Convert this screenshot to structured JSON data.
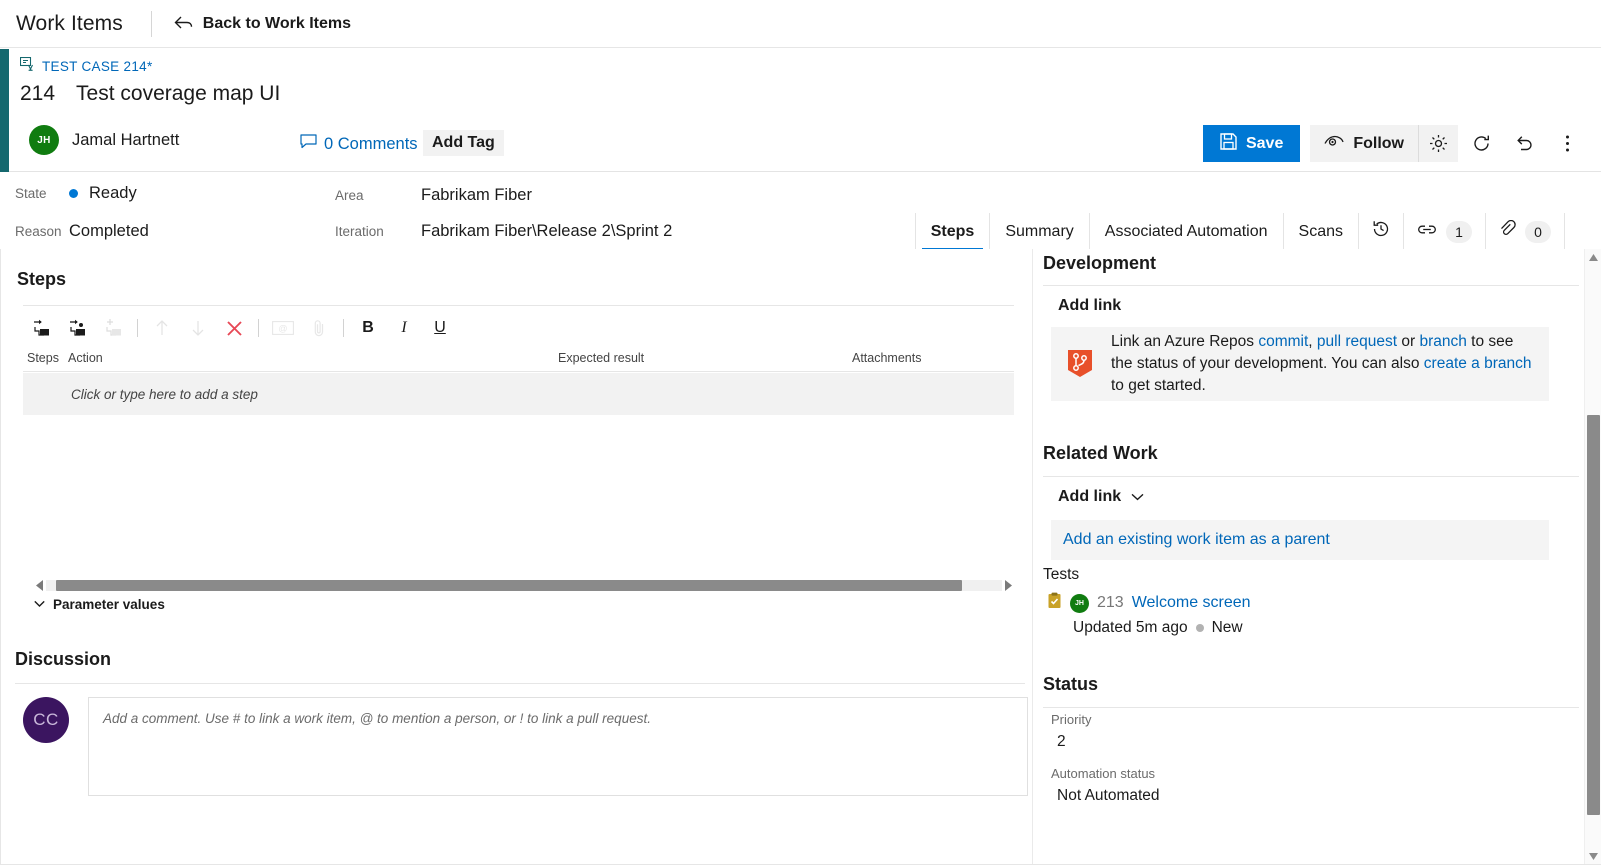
{
  "hub": {
    "title": "Work Items",
    "back_label": "Back to Work Items",
    "back_icon": "back-arrow-icon"
  },
  "work_item": {
    "type_label": "TEST CASE 214*",
    "type_icon": "test-case-icon",
    "id": "214",
    "title": "Test coverage map UI",
    "assigned_to": "Jamal Hartnett",
    "assigned_initials": "JH",
    "comments_label": "0 Comments",
    "comments_icon": "comment-bubble-icon",
    "add_tag_label": "Add Tag",
    "accent_color": "#15686e"
  },
  "toolbar": {
    "save_label": "Save",
    "save_icon": "save-disk-icon",
    "follow_label": "Follow",
    "follow_icon": "eye-icon",
    "gear_icon": "gear-icon",
    "refresh_icon": "refresh-icon",
    "revert_icon": "undo-icon",
    "more_icon": "more-vertical-icon",
    "accent_color": "#0078d4"
  },
  "fields": {
    "state": {
      "label": "State",
      "value": "Ready",
      "dot_color": "#0078d4"
    },
    "reason": {
      "label": "Reason",
      "value": "Completed"
    },
    "area": {
      "label": "Area",
      "value": "Fabrikam Fiber"
    },
    "iteration": {
      "label": "Iteration",
      "value": "Fabrikam Fiber\\Release 2\\Sprint 2"
    }
  },
  "tabs": [
    {
      "label": "Steps",
      "active": true
    },
    {
      "label": "Summary",
      "active": false
    },
    {
      "label": "Associated Automation",
      "active": false
    },
    {
      "label": "Scans",
      "active": false
    }
  ],
  "tab_icons": [
    {
      "name": "history-icon",
      "badge": null
    },
    {
      "name": "links-icon",
      "badge": "1"
    },
    {
      "name": "attachments-icon",
      "badge": "0"
    }
  ],
  "steps_section": {
    "heading": "Steps",
    "toolbar_buttons": [
      {
        "name": "insert-step-icon",
        "disabled": false
      },
      {
        "name": "insert-shared-step-icon",
        "disabled": false
      },
      {
        "name": "insert-step-parameter-icon",
        "disabled": true
      },
      {
        "name": "move-up-icon",
        "disabled": true
      },
      {
        "name": "move-down-icon",
        "disabled": true
      },
      {
        "name": "delete-step-icon",
        "disabled": false
      },
      {
        "name": "insert-parameter-icon",
        "disabled": true
      },
      {
        "name": "attach-file-icon",
        "disabled": true
      },
      {
        "name": "bold-icon",
        "disabled": false,
        "text": "B"
      },
      {
        "name": "italic-icon",
        "disabled": false,
        "text": "I"
      },
      {
        "name": "underline-icon",
        "disabled": false,
        "text": "U"
      }
    ],
    "columns": [
      "Steps",
      "Action",
      "Expected result",
      "Attachments"
    ],
    "empty_row_placeholder": "Click or type here to add a step",
    "parameter_values_label": "Parameter values"
  },
  "discussion": {
    "heading": "Discussion",
    "user_initials": "CC",
    "comment_placeholder": "Add a comment. Use # to link a work item, @ to mention a person, or ! to link a pull request."
  },
  "development": {
    "heading": "Development",
    "add_link_label": "Add link",
    "callout_icon": "azure-repos-icon",
    "callout": {
      "part1": "Link an Azure Repos ",
      "link1": "commit",
      "sep1": ", ",
      "link2": "pull request",
      "part2": " or ",
      "link3": "branch",
      "part3": " to see the status of your development. You can also ",
      "link4": "create a branch",
      "part4": " to get started."
    }
  },
  "related_work": {
    "heading": "Related Work",
    "add_link_label": "Add link",
    "chevron_icon": "chevron-down-icon",
    "add_parent_label": "Add an existing work item as a parent",
    "group_label": "Tests",
    "item": {
      "icon": "test-case-clipboard-icon",
      "avatar_initials": "JH",
      "id": "213",
      "title": "Welcome screen",
      "updated": "Updated 5m ago",
      "state": "New",
      "state_dot_color": "#b2b2b2"
    }
  },
  "status": {
    "heading": "Status",
    "priority_label": "Priority",
    "priority_value": "2",
    "automation_label": "Automation status",
    "automation_value": "Not Automated"
  }
}
